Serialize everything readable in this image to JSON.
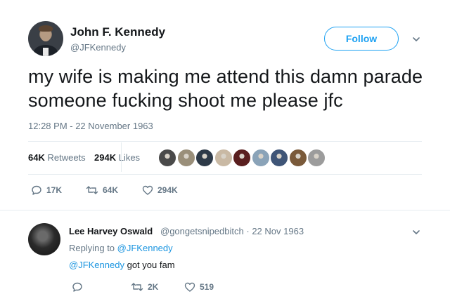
{
  "tweet": {
    "name": "John F. Kennedy",
    "handle": "@JFKennedy",
    "follow_label": "Follow",
    "text": "my wife is making me attend this damn parade someone fucking shoot me please jfc",
    "timestamp": "12:28 PM - 22 November 1963",
    "retweets_count": "64K",
    "retweets_label": "Retweets",
    "likes_count": "294K",
    "likes_label": "Likes",
    "likers_colors": [
      "#4a4a4a",
      "#9a8f7a",
      "#2e3a48",
      "#c9b9a4",
      "#5a1f1f",
      "#8aa3b8",
      "#3f5577",
      "#7a5a3a",
      "#9c9c9c"
    ],
    "actions": {
      "reply_count": "17K",
      "retweet_count": "64K",
      "like_count": "294K"
    }
  },
  "reply": {
    "name": "Lee Harvey Oswald",
    "handle": "@gongetsnipedbitch",
    "separator": "·",
    "date": "22 Nov 1963",
    "replying_prefix": "Replying to",
    "replying_to": "@JFKennedy",
    "mention": "@JFKennedy",
    "text": "got you fam",
    "actions": {
      "reply_count": "",
      "retweet_count": "2K",
      "like_count": "519"
    }
  },
  "colors": {
    "accent": "#1da1f2",
    "link": "#1b95e0",
    "muted": "#657786",
    "text": "#14171a"
  }
}
